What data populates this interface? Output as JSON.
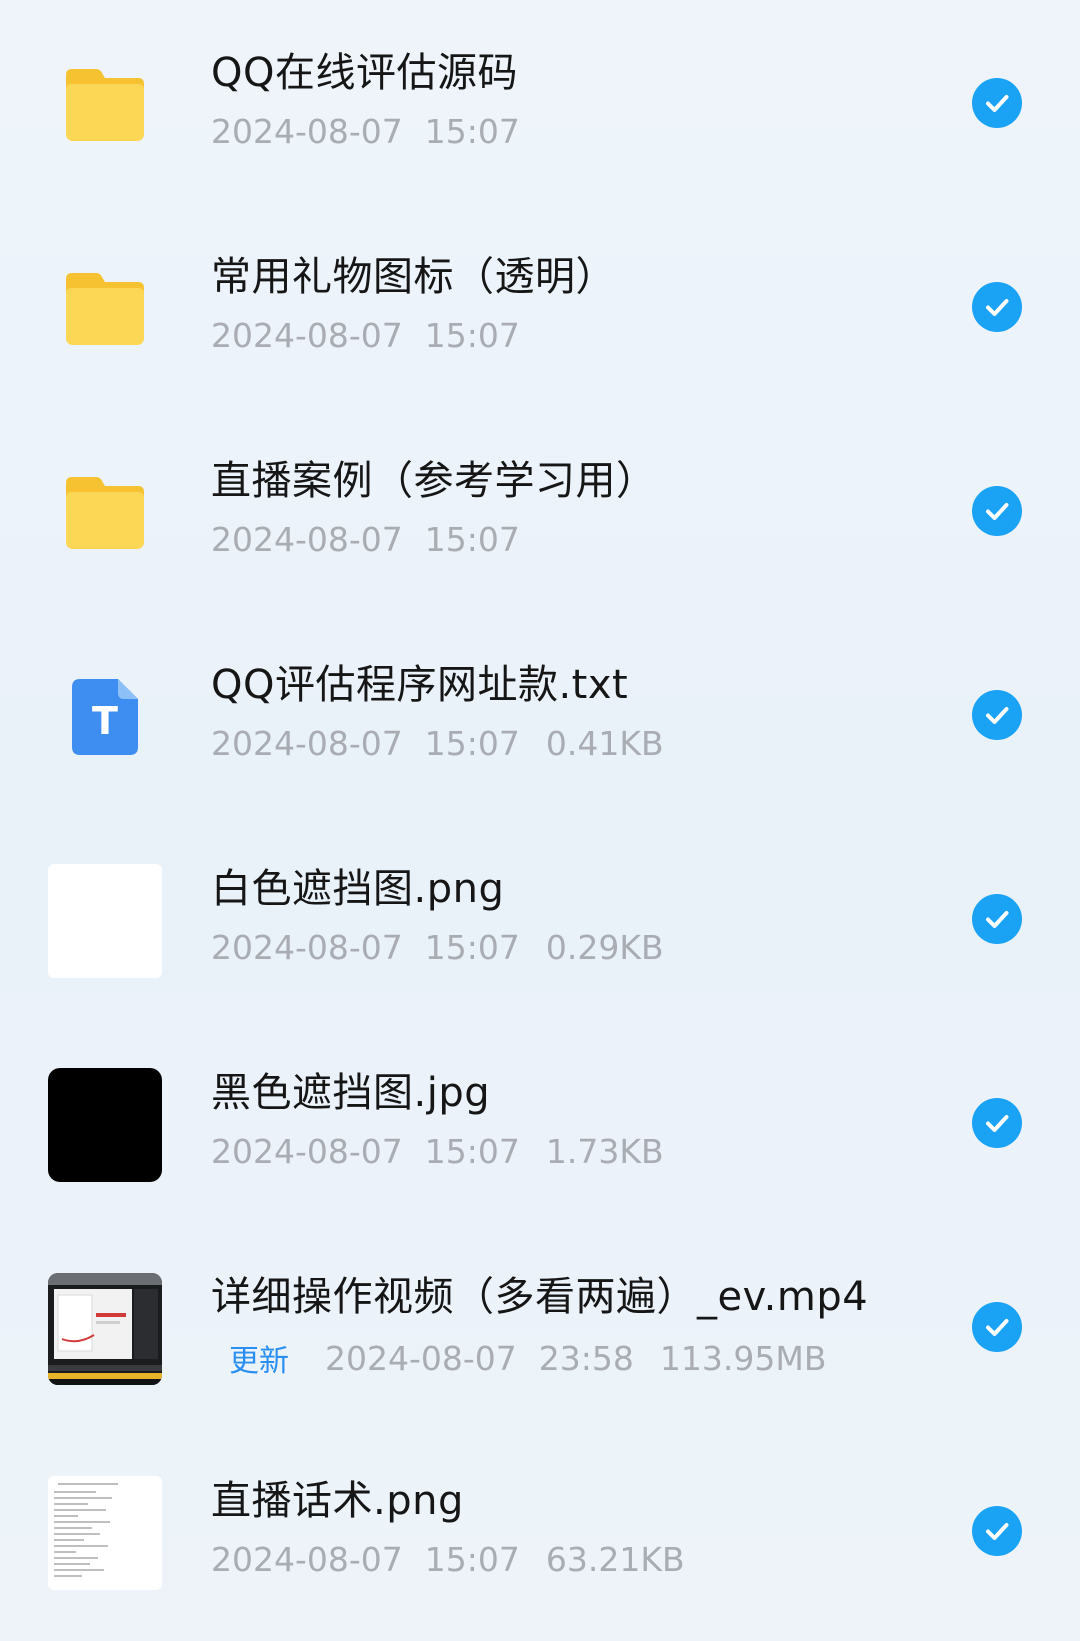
{
  "files": [
    {
      "type": "folder",
      "icon": "folder-icon",
      "name": "QQ在线评估源码",
      "date": "2024-08-07",
      "time": "15:07",
      "size": ""
    },
    {
      "type": "folder",
      "icon": "folder-icon",
      "name": "常用礼物图标（透明）",
      "date": "2024-08-07",
      "time": "15:07",
      "size": ""
    },
    {
      "type": "folder",
      "icon": "folder-icon",
      "name": "直播案例（参考学习用）",
      "date": "2024-08-07",
      "time": "15:07",
      "size": ""
    },
    {
      "type": "txt",
      "icon": "text-file-icon",
      "name": "QQ评估程序网址款.txt",
      "date": "2024-08-07",
      "time": "15:07",
      "size": "0.41KB"
    },
    {
      "type": "png",
      "icon": "image-thumbnail",
      "name": "白色遮挡图.png",
      "date": "2024-08-07",
      "time": "15:07",
      "size": "0.29KB"
    },
    {
      "type": "jpg",
      "icon": "image-thumbnail",
      "name": "黑色遮挡图.jpg",
      "date": "2024-08-07",
      "time": "15:07",
      "size": "1.73KB"
    },
    {
      "type": "mp4",
      "icon": "video-thumbnail",
      "name": "详细操作视频（多看两遍）_ev.mp4",
      "badge": "更新",
      "date": "2024-08-07",
      "time": "23:58",
      "size": "113.95MB"
    },
    {
      "type": "png",
      "icon": "image-thumbnail",
      "name": "直播话术.png",
      "date": "2024-08-07",
      "time": "15:07",
      "size": "63.21KB"
    }
  ],
  "colors": {
    "accent": "#1aa2f5",
    "folder": "#fbd14b",
    "text_file": "#3d8ef0",
    "badge": "#2a8ff0",
    "meta_text": "#a9adb3"
  }
}
